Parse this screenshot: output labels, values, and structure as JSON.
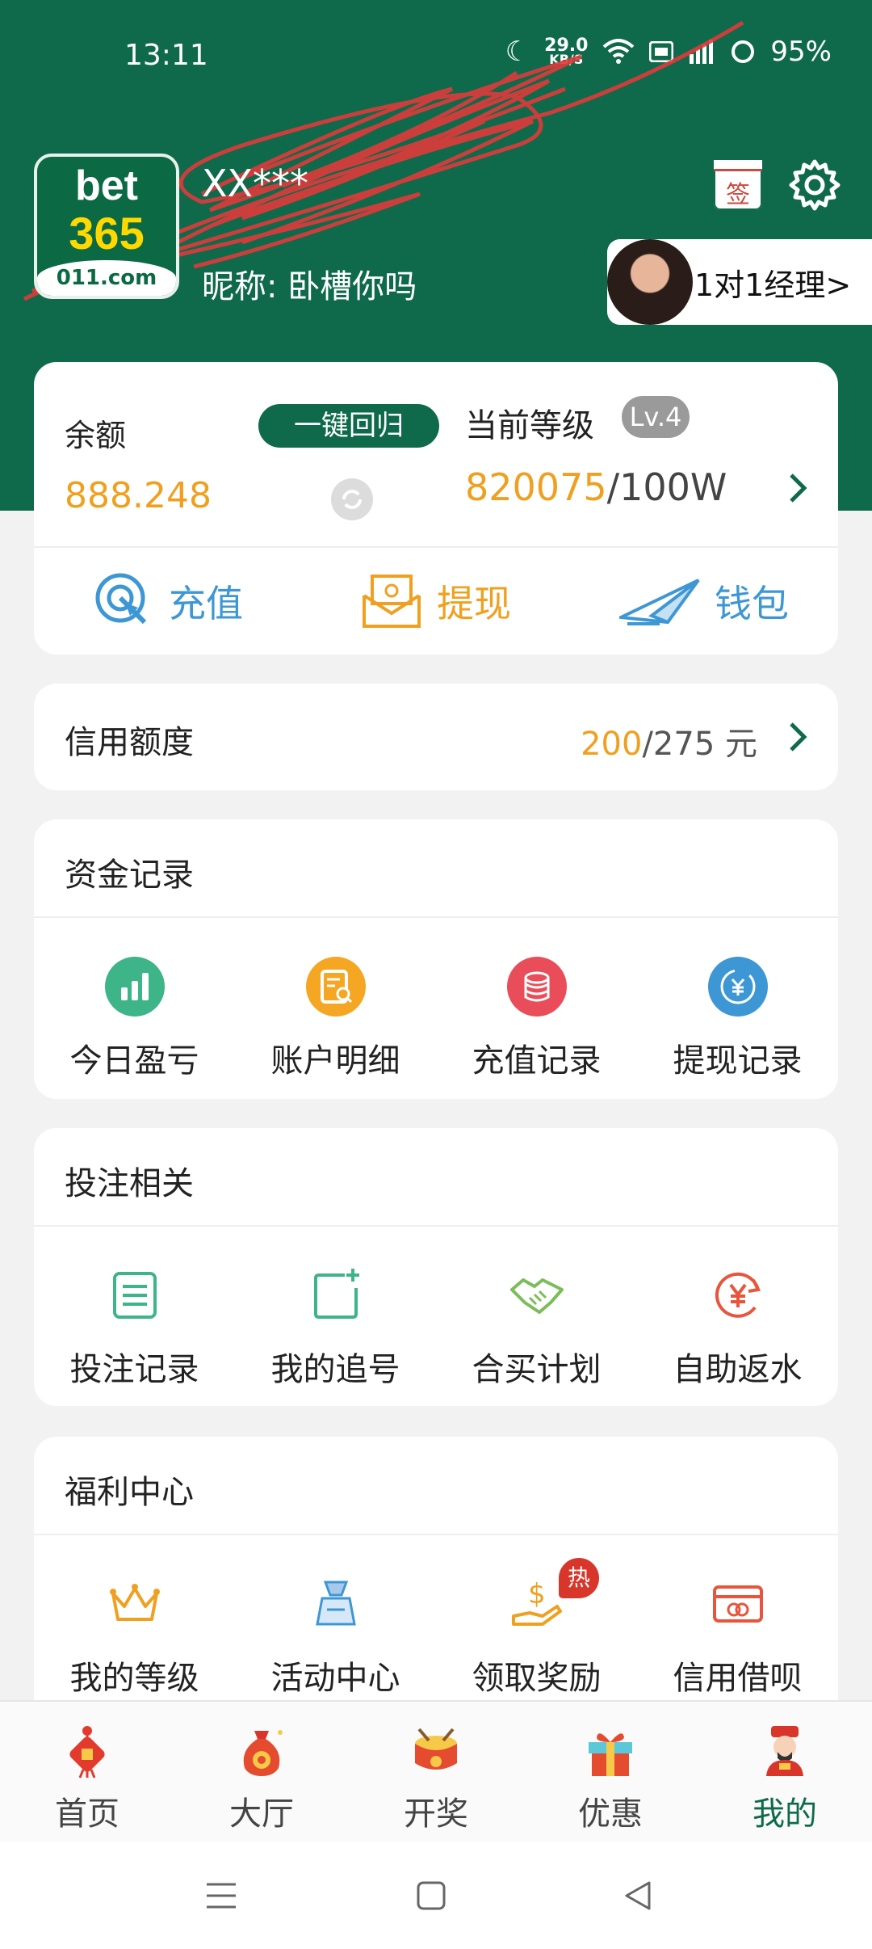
{
  "status_bar": {
    "time": "13:11",
    "net_speed_value": "29.0",
    "net_speed_unit": "KB/S",
    "battery": "95%"
  },
  "profile": {
    "logo_top": "bet",
    "logo_mid": "365",
    "logo_domain": "011.com",
    "username": "XX***",
    "nickname": "昵称: 卧槽你吗",
    "sign_label": "签",
    "manager_label": "1对1经理>"
  },
  "balance_card": {
    "balance_label": "余额",
    "recall_button": "一键回归",
    "balance_value": "888.248",
    "level_label": "当前等级",
    "level_badge": "Lv.4",
    "level_current": "820075",
    "level_target": "/100W",
    "actions": [
      {
        "label": "充值",
        "icon": "target-icon",
        "color": "#3d97d4"
      },
      {
        "label": "提现",
        "icon": "envelope-icon",
        "color": "#f0a020"
      },
      {
        "label": "钱包",
        "icon": "paper-plane-icon",
        "color": "#3d97d4"
      }
    ]
  },
  "credit": {
    "title": "信用额度",
    "used": "200",
    "total": "/275 元"
  },
  "funds_section": {
    "title": "资金记录",
    "items": [
      {
        "label": "今日盈亏",
        "icon": "bar-chart-icon",
        "color": "#3eb489"
      },
      {
        "label": "账户明细",
        "icon": "document-search-icon",
        "color": "#f5a623"
      },
      {
        "label": "充值记录",
        "icon": "coins-icon",
        "color": "#e94d5a"
      },
      {
        "label": "提现记录",
        "icon": "yen-exchange-icon",
        "color": "#3d97d4"
      }
    ]
  },
  "bets_section": {
    "title": "投注相关",
    "items": [
      {
        "label": "投注记录",
        "icon": "list-icon",
        "color": "#3eb489"
      },
      {
        "label": "我的追号",
        "icon": "add-square-icon",
        "color": "#3eb489"
      },
      {
        "label": "合买计划",
        "icon": "handshake-icon",
        "color": "#7bbd5a"
      },
      {
        "label": "自助返水",
        "icon": "yen-refresh-icon",
        "color": "#e8553c"
      }
    ]
  },
  "welfare_section": {
    "title": "福利中心",
    "items": [
      {
        "label": "我的等级",
        "icon": "crown-icon",
        "color": "#f0a020"
      },
      {
        "label": "活动中心",
        "icon": "gift-bag-icon",
        "color": "#3d97d4"
      },
      {
        "label": "领取奖励",
        "icon": "dollar-hand-icon",
        "color": "#f0a020",
        "badge": "热"
      },
      {
        "label": "信用借呗",
        "icon": "credit-card-icon",
        "color": "#e8553c"
      }
    ]
  },
  "tabs": [
    {
      "label": "首页",
      "icon": "chinese-knot-icon",
      "active": false
    },
    {
      "label": "大厅",
      "icon": "money-bag-icon",
      "active": false
    },
    {
      "label": "开奖",
      "icon": "drum-icon",
      "active": false
    },
    {
      "label": "优惠",
      "icon": "gift-box-icon",
      "active": false
    },
    {
      "label": "我的",
      "icon": "fortune-god-icon",
      "active": true
    }
  ]
}
